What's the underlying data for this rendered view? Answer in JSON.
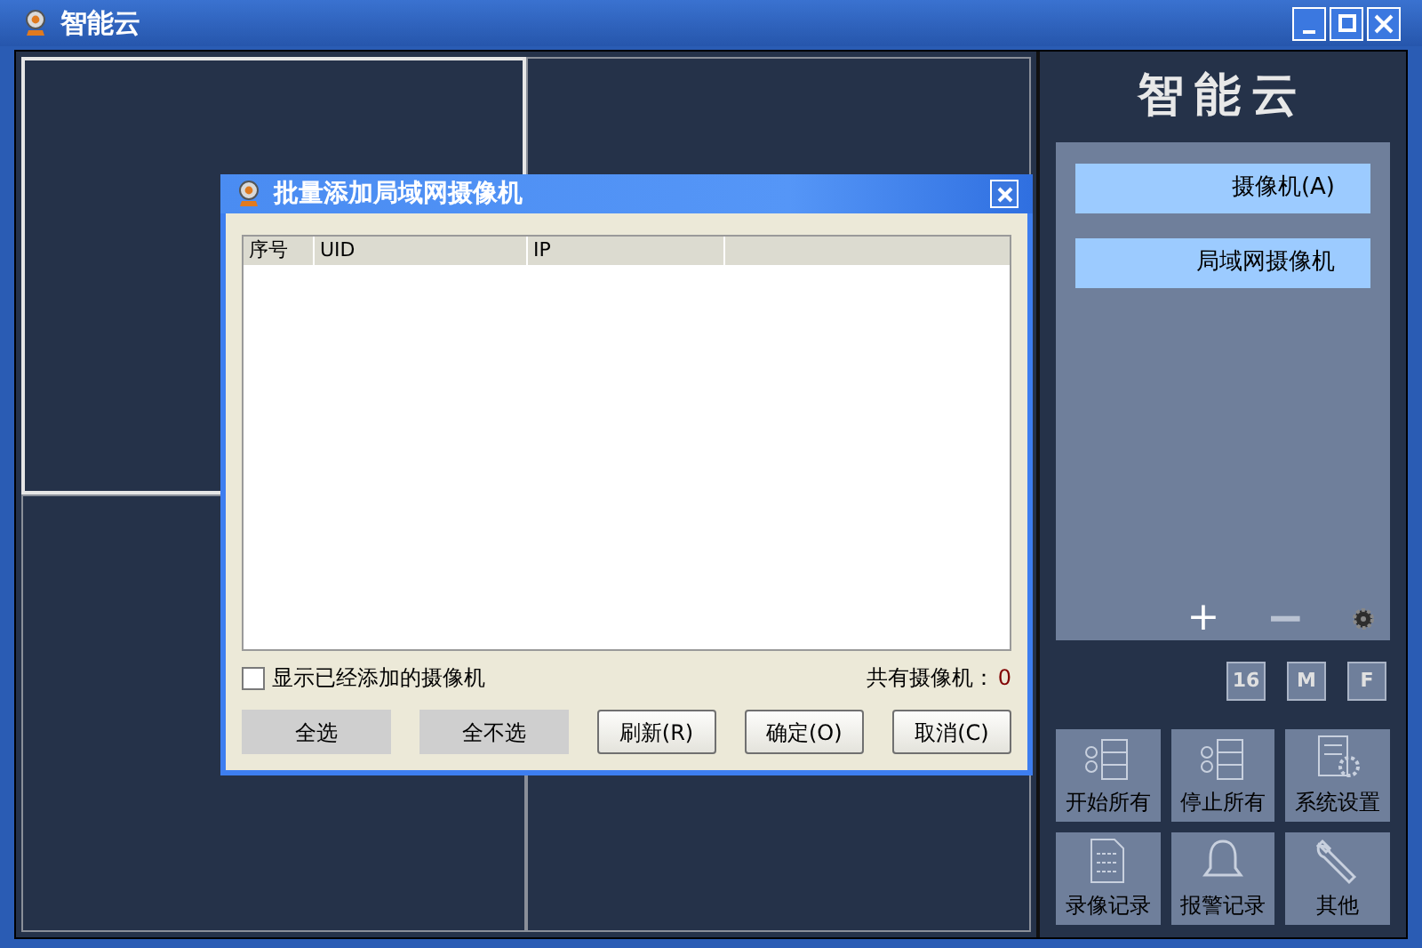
{
  "window": {
    "title": "智能云"
  },
  "sidebar": {
    "logo": "智能云",
    "actions": [
      {
        "label": "摄像机(A)"
      },
      {
        "label": "局域网摄像机"
      }
    ],
    "tools": [
      {
        "kind": "plus",
        "label": "+"
      },
      {
        "kind": "minus",
        "label": "−"
      },
      {
        "kind": "gear"
      }
    ],
    "layouts": [
      {
        "label": "16"
      },
      {
        "label": "M"
      },
      {
        "label": "F"
      }
    ],
    "buttons": [
      {
        "kind": "start",
        "label": "开始所有"
      },
      {
        "kind": "stop",
        "label": "停止所有"
      },
      {
        "kind": "settings",
        "label": "系统设置"
      },
      {
        "kind": "record",
        "label": "录像记录"
      },
      {
        "kind": "alarm",
        "label": "报警记录"
      },
      {
        "kind": "other",
        "label": "其他"
      }
    ]
  },
  "dialog": {
    "title": "批量添加局域网摄像机",
    "table": {
      "columns": [
        "序号",
        "UID",
        "IP"
      ]
    },
    "show_added": {
      "label": "显示已经添加的摄像机",
      "checked": false
    },
    "count": {
      "label": "共有摄像机：",
      "value": "0"
    },
    "buttons": [
      {
        "kind": "flat",
        "label": "全选"
      },
      {
        "kind": "flat",
        "label": "全不选"
      },
      {
        "kind": "raised",
        "label": "刷新(R)"
      },
      {
        "kind": "raised",
        "label": "确定(O)"
      },
      {
        "kind": "raised",
        "label": "取消(C)"
      }
    ]
  }
}
